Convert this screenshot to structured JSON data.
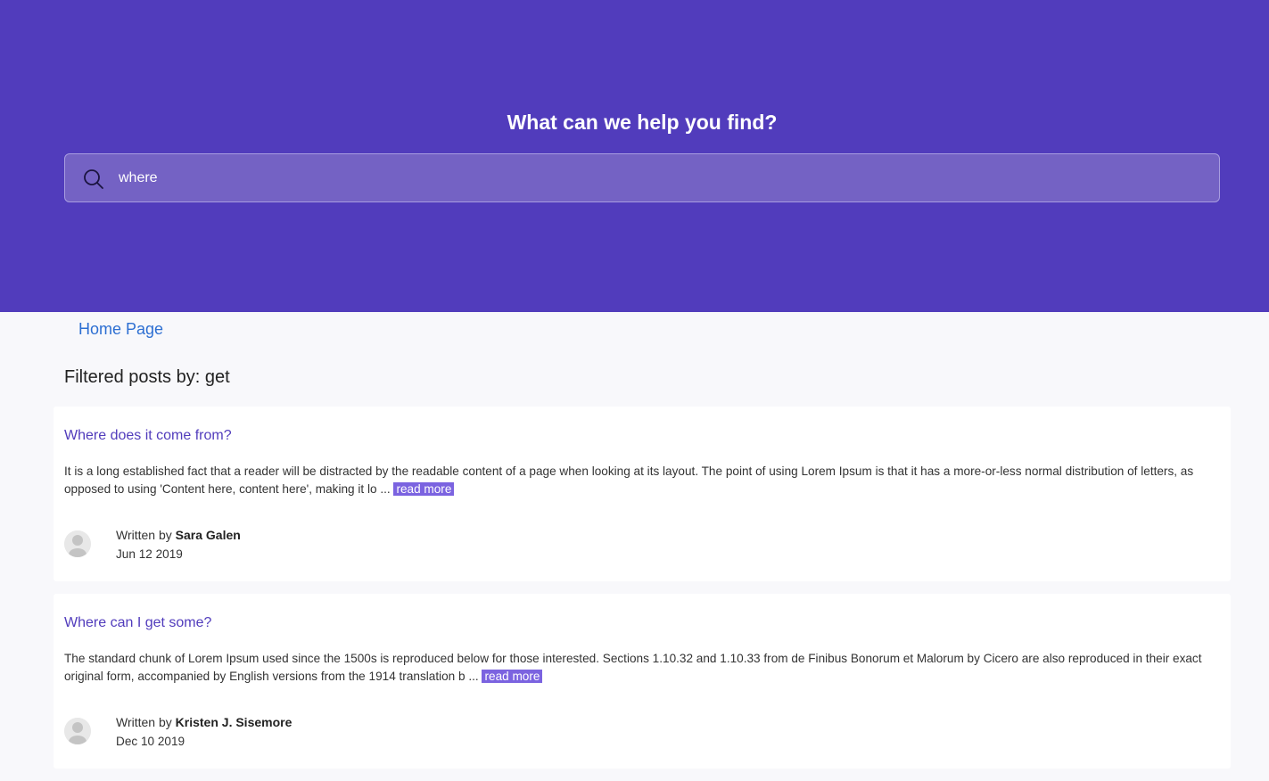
{
  "hero": {
    "title": "What can we help you find?",
    "search": {
      "value": "where",
      "icon": "search-icon"
    }
  },
  "breadcrumb": {
    "home_label": "Home Page"
  },
  "filter": {
    "label": "Filtered posts by:",
    "term": "get"
  },
  "posts": [
    {
      "title": "Where does it come from?",
      "excerpt": "It is a long established fact that a reader will be distracted by the readable content of a page when looking at its layout. The point of using Lorem Ipsum is that it has a more-or-less normal distribution of letters, as opposed to using 'Content here, content here', making it lo ...",
      "read_more": "read more",
      "written_by_label": "Written by",
      "author": "Sara Galen",
      "date": "Jun 12 2019"
    },
    {
      "title": "Where can I get some?",
      "excerpt": "The standard chunk of Lorem Ipsum used since the 1500s is reproduced below for those interested. Sections 1.10.32 and 1.10.33 from de Finibus Bonorum et Malorum by Cicero are also reproduced in their exact original form, accompanied by English versions from the 1914 translation b ...",
      "read_more": "read more",
      "written_by_label": "Written by",
      "author": "Kristen J. Sisemore",
      "date": "Dec 10 2019"
    }
  ],
  "colors": {
    "hero_bg": "#513cbc",
    "search_bg": "#7462c4",
    "link_blue": "#2d6fd2",
    "post_title": "#513cbc",
    "read_more_bg": "#7b63e0"
  }
}
